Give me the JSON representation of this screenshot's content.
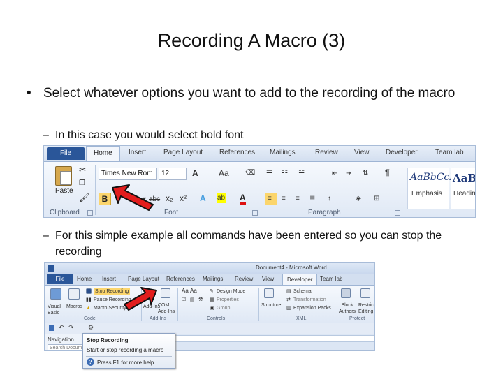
{
  "slide": {
    "title": "Recording A Macro (3)",
    "bullet_symbol": "•",
    "dash_symbol": "–",
    "bullet_1": "Select whatever options you want to add to the recording of the macro",
    "sub_bullet_1": "In this case you would select bold font",
    "sub_bullet_2": "For this simple example all commands have been entered so you can stop the recording"
  },
  "home_ribbon": {
    "tabs": [
      "File",
      "Home",
      "Insert",
      "Page Layout",
      "References",
      "Mailings",
      "Review",
      "View",
      "Developer",
      "Team lab"
    ],
    "active_tab": "Home",
    "clipboard": {
      "paste_label": "Paste",
      "group_label": "Clipboard"
    },
    "font": {
      "font_name": "Times New Rom",
      "font_size": "12",
      "bold": "B",
      "underline": "U",
      "grow": "A",
      "case": "Aa",
      "group_label": "Font",
      "strike": "abc",
      "subscript": "x₂",
      "superscript": "x²",
      "text_color": "A",
      "highlight": "ab"
    },
    "paragraph": {
      "group_label": "Paragraph",
      "pilcrow": "¶"
    },
    "styles": [
      {
        "preview": "AaBbCcL",
        "name": "Emphasis"
      },
      {
        "preview": "AaBl",
        "name": "Headin"
      }
    ]
  },
  "developer_ribbon": {
    "window_title": "Document4 - Microsoft Word",
    "tabs": [
      "File",
      "Home",
      "Insert",
      "Page Layout",
      "References",
      "Mailings",
      "Review",
      "View",
      "Developer",
      "Team lab"
    ],
    "active_tab": "Developer",
    "code": {
      "visual_basic": "Visual Basic",
      "macros": "Macros",
      "stop_recording": "Stop Recording",
      "pause_recording": "Pause Recording",
      "macro_security": "Macro Security",
      "group_label": "Code"
    },
    "addins": {
      "addins": "Add-Ins",
      "com_addins": "COM Add-Ins",
      "group_label": "Add-Ins"
    },
    "controls": {
      "aa_1": "Aa",
      "aa_2": "Aa",
      "design_mode": "Design Mode",
      "properties": "Properties",
      "group": "Group",
      "group_label": "Controls"
    },
    "xml": {
      "structure": "Structure",
      "schema": "Schema",
      "transformation": "Transformation",
      "expansion_packs": "Expansion Packs",
      "group_label": "XML"
    },
    "protect": {
      "block_authors": "Block Authors",
      "restrict_editing": "Restrict Editing",
      "group_label": "Protect"
    },
    "navigation_label": "Navigation",
    "search_placeholder": "Search Docum"
  },
  "tooltip": {
    "title": "Stop Recording",
    "description": "Start or stop recording a macro",
    "help": "Press F1 for more help.",
    "help_icon": "?"
  },
  "colors": {
    "arrow_red": "#e21d1d",
    "file_tab": "#2a5699",
    "ribbon_bg": "#dce6f4"
  }
}
